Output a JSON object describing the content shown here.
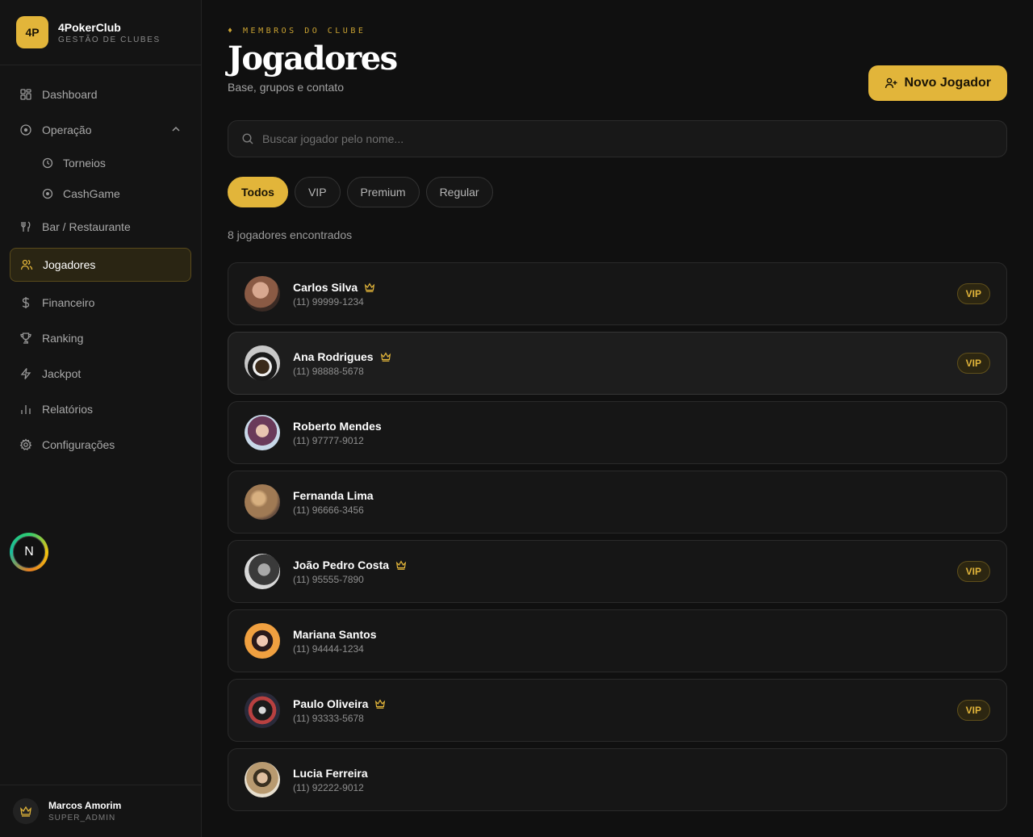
{
  "brand": {
    "logo": "4P",
    "name": "4PokerClub",
    "subtitle": "GESTÃO DE CLUBES"
  },
  "nav": {
    "dashboard": "Dashboard",
    "operacao": "Operação",
    "torneios": "Torneios",
    "cashgame": "CashGame",
    "bar": "Bar / Restaurante",
    "jogadores": "Jogadores",
    "financeiro": "Financeiro",
    "ranking": "Ranking",
    "jackpot": "Jackpot",
    "relatorios": "Relatórios",
    "configuracoes": "Configurações"
  },
  "dev_badge": "N",
  "user": {
    "name": "Marcos Amorim",
    "role": "SUPER_ADMIN"
  },
  "header": {
    "eyebrow": "♦ MEMBROS DO CLUBE",
    "title": "Jogadores",
    "subtitle": "Base, grupos e contato",
    "new_button": "Novo Jogador"
  },
  "search": {
    "placeholder": "Buscar jogador pelo nome..."
  },
  "filters": [
    "Todos",
    "VIP",
    "Premium",
    "Regular"
  ],
  "count_text": "8 jogadores encontrados",
  "players": [
    {
      "name": "Carlos Silva",
      "phone": "(11) 99999-1234",
      "vip": "VIP",
      "avatar_color": "#8a5a44"
    },
    {
      "name": "Ana Rodrigues",
      "phone": "(11) 98888-5678",
      "vip": "VIP",
      "avatar_color": "#6b6b4a"
    },
    {
      "name": "Roberto Mendes",
      "phone": "(11) 97777-9012",
      "vip": "",
      "avatar_color": "#8a5a7a"
    },
    {
      "name": "Fernanda Lima",
      "phone": "(11) 96666-3456",
      "vip": "",
      "avatar_color": "#a07a54"
    },
    {
      "name": "João Pedro Costa",
      "phone": "(11) 95555-7890",
      "vip": "VIP",
      "avatar_color": "#555555"
    },
    {
      "name": "Mariana Santos",
      "phone": "(11) 94444-1234",
      "vip": "",
      "avatar_color": "#e8a040"
    },
    {
      "name": "Paulo Oliveira",
      "phone": "(11) 93333-5678",
      "vip": "VIP",
      "avatar_color": "#7a3a3a"
    },
    {
      "name": "Lucia Ferreira",
      "phone": "(11) 92222-9012",
      "vip": "",
      "avatar_color": "#9a8a6a"
    }
  ],
  "colors": {
    "accent": "#e2b53a",
    "background": "#101010",
    "panel": "#161616"
  }
}
